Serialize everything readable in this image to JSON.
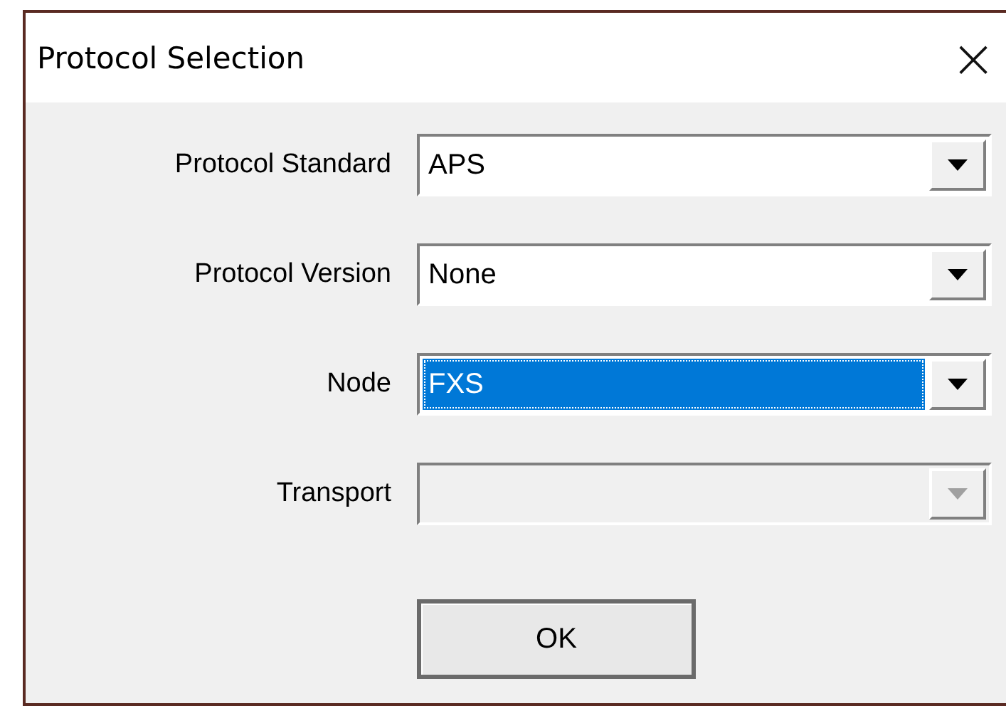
{
  "window": {
    "title": "Protocol Selection",
    "close": "×"
  },
  "fields": [
    {
      "label": "Protocol Standard",
      "value": "APS",
      "highlighted": false,
      "disabled": false
    },
    {
      "label": "Protocol Version",
      "value": "None",
      "highlighted": false,
      "disabled": false
    },
    {
      "label": "Node",
      "value": "FXS",
      "highlighted": true,
      "disabled": false
    },
    {
      "label": "Transport",
      "highlighted": false,
      "disabled": true
    }
  ],
  "buttons": [
    "OK"
  ]
}
